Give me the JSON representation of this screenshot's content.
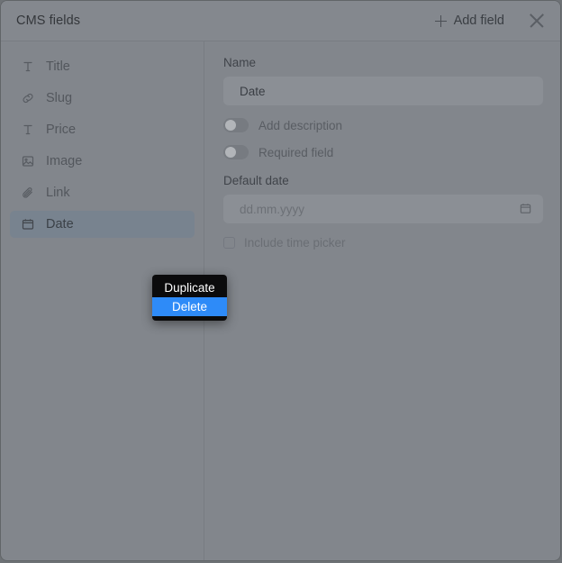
{
  "header": {
    "title": "CMS fields",
    "add_field_label": "Add field",
    "add_icon": "plus-icon",
    "close_icon": "close-icon"
  },
  "sidebar": {
    "items": [
      {
        "label": "Title",
        "icon": "text-icon",
        "selected": false
      },
      {
        "label": "Slug",
        "icon": "link-chain-icon",
        "selected": false
      },
      {
        "label": "Price",
        "icon": "text-icon",
        "selected": false
      },
      {
        "label": "Image",
        "icon": "image-icon",
        "selected": false
      },
      {
        "label": "Link",
        "icon": "paperclip-icon",
        "selected": false
      },
      {
        "label": "Date",
        "icon": "calendar-icon",
        "selected": true
      }
    ]
  },
  "panel": {
    "name_label": "Name",
    "name_value": "Date",
    "name_placeholder": "Name",
    "add_description_label": "Add description",
    "add_description_on": false,
    "required_field_label": "Required field",
    "required_field_on": false,
    "default_date_label": "Default date",
    "default_date_value": "",
    "default_date_placeholder": "dd.mm.yyyy",
    "calendar_icon": "calendar-icon",
    "include_time_picker_label": "Include time picker",
    "include_time_picker_checked": false
  },
  "context_menu": {
    "items": [
      {
        "label": "Duplicate",
        "active": false
      },
      {
        "label": "Delete",
        "active": true
      }
    ]
  },
  "colors": {
    "dialog_bg": "#82868c",
    "page_bg": "#6e7276",
    "selected_item": "#78838f",
    "menu_bg": "#0b0b0c",
    "menu_highlight": "#2e8bf8",
    "input_bg": "#8b8f95"
  }
}
